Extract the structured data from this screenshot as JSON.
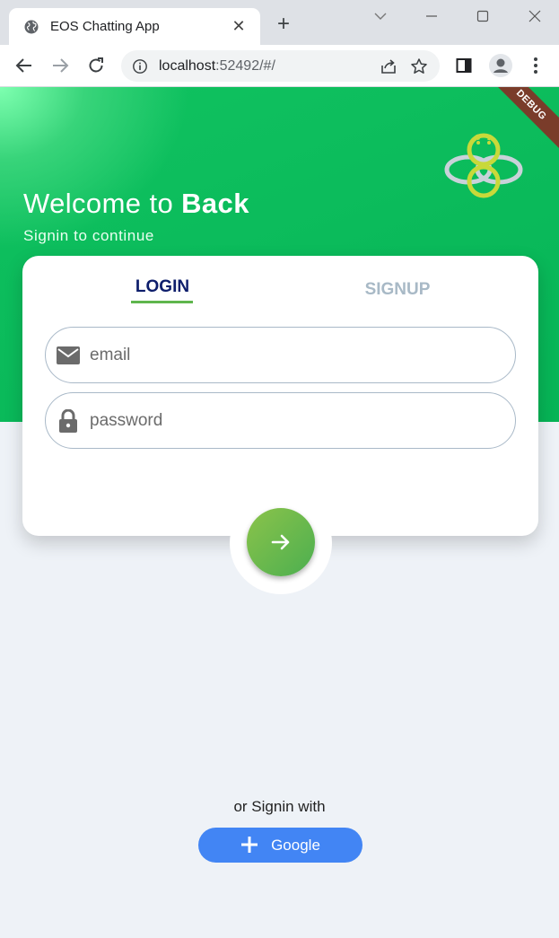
{
  "browser": {
    "tab_title": "EOS Chatting App",
    "tab_close": "✕",
    "new_tab": "+",
    "url_host": "localhost",
    "url_rest": ":52492/#/"
  },
  "app": {
    "debug_banner": "DEBUG",
    "welcome_prefix": "Welcome to ",
    "welcome_bold": "Back",
    "subtitle": "Signin to continue",
    "tabs": {
      "login": "LOGIN",
      "signup": "SIGNUP"
    },
    "email_placeholder": "email",
    "password_placeholder": "password",
    "or_text": "or Signin with",
    "google_label": "Google",
    "icons": {
      "email": "mail-icon",
      "password": "lock-icon",
      "submit": "arrow-right-icon",
      "google": "plus-icon"
    }
  },
  "colors": {
    "header_green": "#06b456",
    "login_tab": "#0d1d6b",
    "signup_tab": "#a8b9c6",
    "tab_underline": "#5fb64d",
    "google_blue": "#4285f4",
    "submit_green": "#4caf50"
  }
}
